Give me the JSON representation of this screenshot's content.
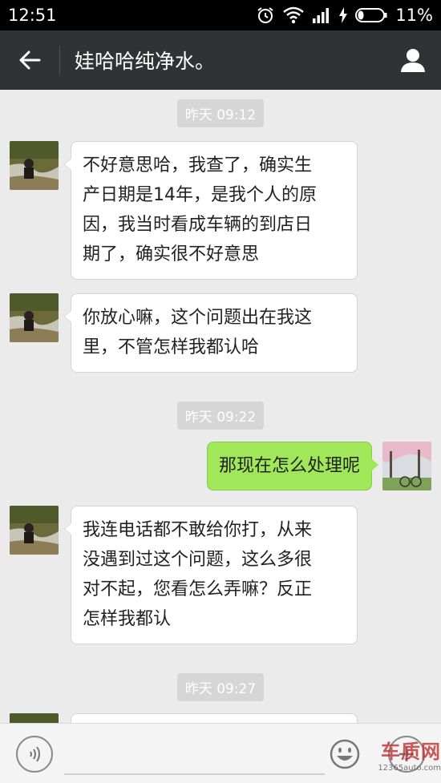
{
  "status_bar": {
    "time": "12:51",
    "battery": "11%"
  },
  "header": {
    "title": "娃哈哈纯净水。"
  },
  "messages": {
    "ts1": "昨天 09:12",
    "m1": [
      "不好意思哈，我查了，确实生",
      "产日期是14年，是我个人的原",
      "因，我当时看成车辆的到店日",
      "期了，确实很不好意思"
    ],
    "m2": [
      "你放心嘛，这个问题出在我这",
      "里，不管怎样我都认哈"
    ],
    "ts2": "昨天 09:22",
    "m3": "那现在怎么处理呢",
    "m4": [
      "我连电话都不敢给你打，从来",
      "没遇到过这个问题，这么多很",
      "对不起，您看怎么弄嘛？反正",
      "怎样我都认"
    ],
    "ts3": "昨天 09:27"
  },
  "watermark": {
    "brand": "车质网",
    "url": "12365auto.com"
  },
  "colors": {
    "status_bar": "#000000",
    "title_bar": "#2f3336",
    "chat_bg": "#ebebeb",
    "bubble_out": "#a0e75a",
    "bubble_in": "#ffffff"
  },
  "icons": {
    "back": "back-arrow-icon",
    "profile": "person-icon",
    "voice": "voice-icon",
    "emoji": "smiley-icon",
    "plus": "plus-icon"
  }
}
